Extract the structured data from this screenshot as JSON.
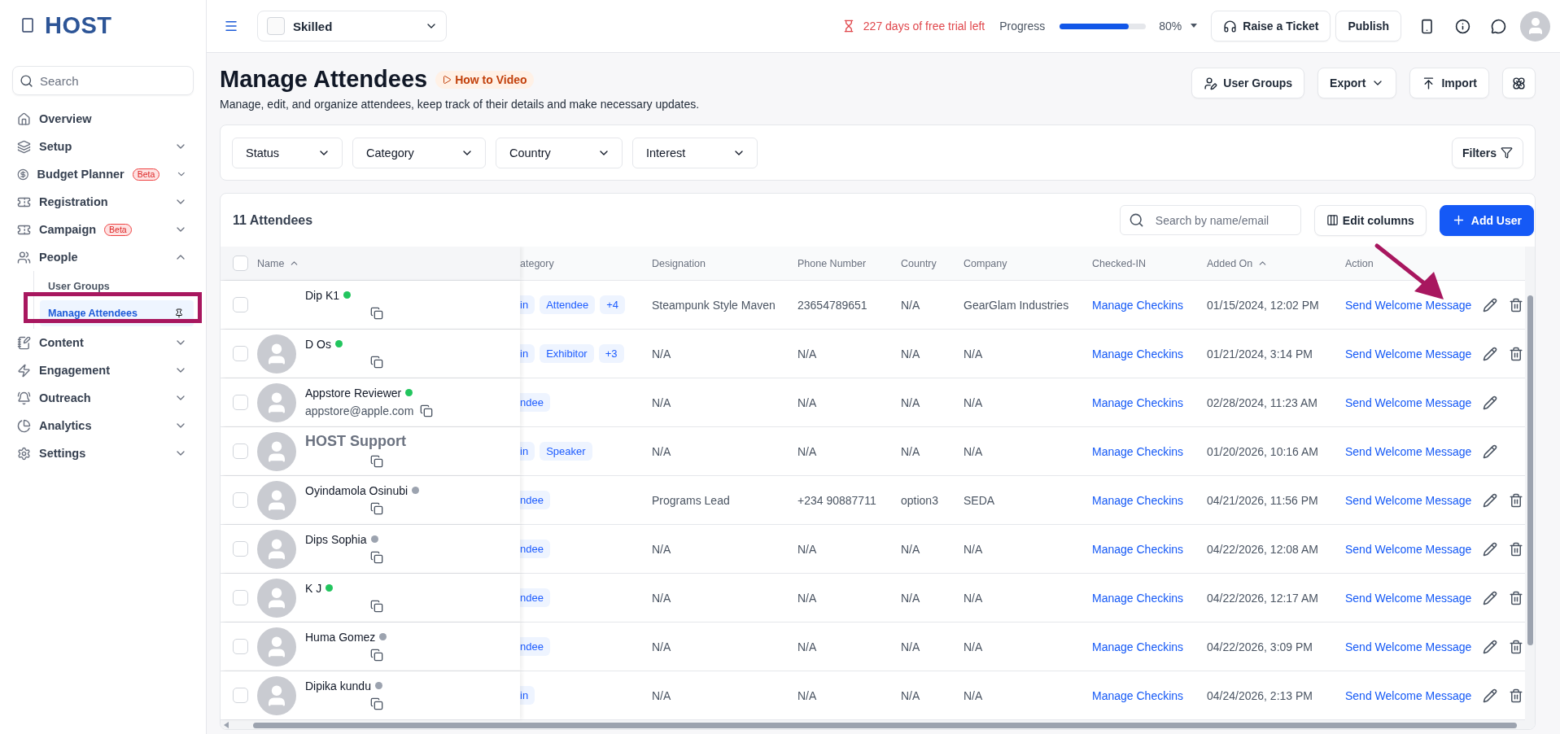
{
  "sidebar": {
    "logo": "HOST",
    "search": {
      "placeholder": "Search"
    },
    "items": [
      {
        "label": "Overview",
        "kind": "link"
      },
      {
        "label": "Setup",
        "kind": "group",
        "expanded": false
      },
      {
        "label": "Budget Planner",
        "kind": "group",
        "expanded": false,
        "badge": "Beta"
      },
      {
        "label": "Registration",
        "kind": "group",
        "expanded": false
      },
      {
        "label": "Campaign",
        "kind": "group",
        "expanded": false,
        "badge": "Beta"
      },
      {
        "label": "People",
        "kind": "group",
        "expanded": true,
        "children": [
          {
            "label": "User Groups",
            "selected": false,
            "pinned": false
          },
          {
            "label": "Manage Attendees",
            "selected": true,
            "pinned": true
          }
        ]
      },
      {
        "label": "Content",
        "kind": "group",
        "expanded": false
      },
      {
        "label": "Engagement",
        "kind": "group",
        "expanded": false
      },
      {
        "label": "Outreach",
        "kind": "group",
        "expanded": false
      },
      {
        "label": "Analytics",
        "kind": "group",
        "expanded": false
      },
      {
        "label": "Settings",
        "kind": "group",
        "expanded": false
      }
    ]
  },
  "topbar": {
    "project": "Skilled",
    "trial": "227 days of free trial left",
    "progress_label": "Progress",
    "progress": {
      "level": 0.8
    },
    "progress_reading": "80%",
    "buttons": [
      "Raise a Ticket",
      "Publish"
    ]
  },
  "header": {
    "title": "Manage Attendees",
    "video_link": "How to Video",
    "subtitle": "Manage, edit, and organize attendees, keep track of their details and make necessary updates.",
    "actions": [
      "User Groups",
      "Export",
      "Import"
    ]
  },
  "filters": {
    "dropdowns": [
      "Status",
      "Category",
      "Country",
      "Interest"
    ],
    "button": "Filters"
  },
  "table": {
    "count": "11 Attendees",
    "search": {
      "placeholder": "Search by name/email"
    },
    "edit_columns": "Edit columns",
    "add_user": "Add User",
    "all_selected": false,
    "columns": [
      {
        "label": "Name",
        "sorted": true
      },
      {
        "label": "ategory",
        "sorted": false
      },
      {
        "label": "Designation",
        "sorted": false
      },
      {
        "label": "Phone Number",
        "sorted": false
      },
      {
        "label": "Country",
        "sorted": false
      },
      {
        "label": "Company",
        "sorted": false
      },
      {
        "label": "Checked-IN",
        "sorted": false
      },
      {
        "label": "Added On",
        "sorted": true
      },
      {
        "label": "Action",
        "sorted": false
      }
    ],
    "rows": [
      {
        "selected": false,
        "name": "Dip K1",
        "online": true,
        "avatar": false,
        "large": false,
        "categories": [
          "in",
          "Attendee",
          "+4"
        ],
        "designation": "Steampunk Style Maven",
        "phone": "23654789651",
        "country": "N/A",
        "company": "GearGlam Industries",
        "checkin": "Manage Checkins",
        "added": "01/15/2024, 12:02 PM",
        "action": "Send Welcome Message",
        "deletable": true
      },
      {
        "selected": false,
        "name": "D Os",
        "online": true,
        "avatar": true,
        "large": false,
        "categories": [
          "in",
          "Exhibitor",
          "+3"
        ],
        "designation": "N/A",
        "phone": "N/A",
        "country": "N/A",
        "company": "N/A",
        "checkin": "Manage Checkins",
        "added": "01/21/2024, 3:14 PM",
        "action": "Send Welcome Message",
        "deletable": true
      },
      {
        "selected": false,
        "name": "Appstore Reviewer",
        "online": true,
        "avatar": true,
        "large": false,
        "email": "appstore@apple.com",
        "categories": [
          "ndee"
        ],
        "designation": "N/A",
        "phone": "N/A",
        "country": "N/A",
        "company": "N/A",
        "checkin": "Manage Checkins",
        "added": "02/28/2024, 11:23 AM",
        "action": "Send Welcome Message",
        "deletable": false
      },
      {
        "selected": false,
        "name": "HOST Support",
        "avatar": true,
        "large": true,
        "categories": [
          "in",
          "Speaker"
        ],
        "designation": "N/A",
        "phone": "N/A",
        "country": "N/A",
        "company": "N/A",
        "checkin": "Manage Checkins",
        "added": "01/20/2026, 10:16 AM",
        "action": "Send Welcome Message",
        "deletable": false
      },
      {
        "selected": false,
        "name": "Oyindamola Osinubi",
        "online": false,
        "avatar": true,
        "large": false,
        "categories": [
          "ndee"
        ],
        "designation": "Programs Lead",
        "phone": "+234 90887711",
        "country": "option3",
        "company": "SEDA",
        "checkin": "Manage Checkins",
        "added": "04/21/2026, 11:56 PM",
        "action": "Send Welcome Message",
        "deletable": true
      },
      {
        "selected": false,
        "name": "Dips Sophia",
        "online": false,
        "avatar": true,
        "large": false,
        "categories": [
          "ndee"
        ],
        "designation": "N/A",
        "phone": "N/A",
        "country": "N/A",
        "company": "N/A",
        "checkin": "Manage Checkins",
        "added": "04/22/2026, 12:08 AM",
        "action": "Send Welcome Message",
        "deletable": true
      },
      {
        "selected": false,
        "name": "K J",
        "online": true,
        "avatar": true,
        "large": false,
        "categories": [
          "ndee"
        ],
        "designation": "N/A",
        "phone": "N/A",
        "country": "N/A",
        "company": "N/A",
        "checkin": "Manage Checkins",
        "added": "04/22/2026, 12:17 AM",
        "action": "Send Welcome Message",
        "deletable": true
      },
      {
        "selected": false,
        "name": "Huma Gomez",
        "online": false,
        "avatar": true,
        "large": false,
        "categories": [
          "ndee"
        ],
        "designation": "N/A",
        "phone": "N/A",
        "country": "N/A",
        "company": "N/A",
        "checkin": "Manage Checkins",
        "added": "04/22/2026, 3:09 PM",
        "action": "Send Welcome Message",
        "deletable": true
      },
      {
        "selected": false,
        "name": "Dipika kundu",
        "online": false,
        "avatar": true,
        "large": false,
        "categories": [
          "in"
        ],
        "designation": "N/A",
        "phone": "N/A",
        "country": "N/A",
        "company": "N/A",
        "checkin": "Manage Checkins",
        "added": "04/24/2026, 2:13 PM",
        "action": "Send Welcome Message",
        "deletable": true
      }
    ]
  }
}
